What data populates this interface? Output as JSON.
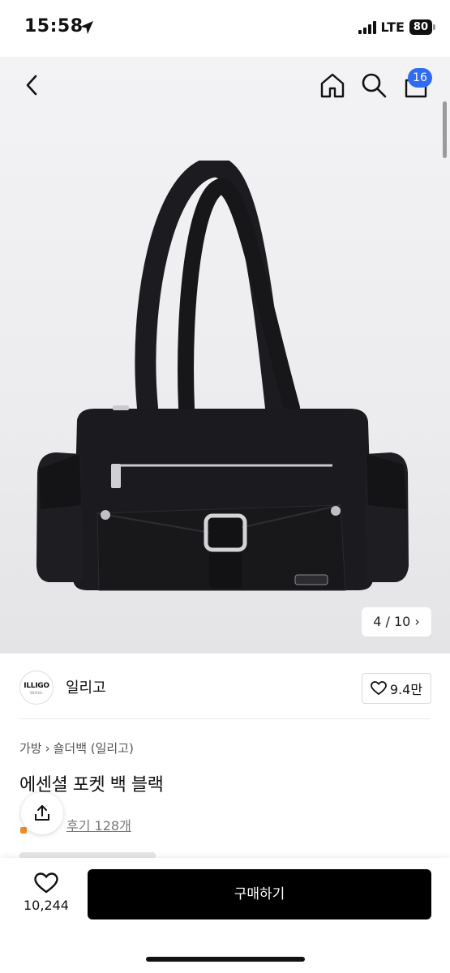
{
  "status_bar": {
    "time": "15:58",
    "network": "LTE",
    "battery": "80"
  },
  "header": {
    "cart_count": "16"
  },
  "gallery": {
    "pager": "4 / 10 ›"
  },
  "shop": {
    "logo_text": "ILLIGO",
    "logo_sub": "SEOUL",
    "name": "일리고",
    "likes": "9.4만"
  },
  "product": {
    "breadcrumb": [
      "가방",
      "숄더백 (일리고)"
    ],
    "breadcrumb_separator": "›",
    "title": "에센셜 포켓 백 블랙",
    "review_link": "후기 128개"
  },
  "bottom_bar": {
    "wish_count": "10,244",
    "buy_label": "구매하기"
  },
  "colors": {
    "badge": "#2f6cf3",
    "buy_button": "#000000",
    "star": "#f28c28"
  }
}
